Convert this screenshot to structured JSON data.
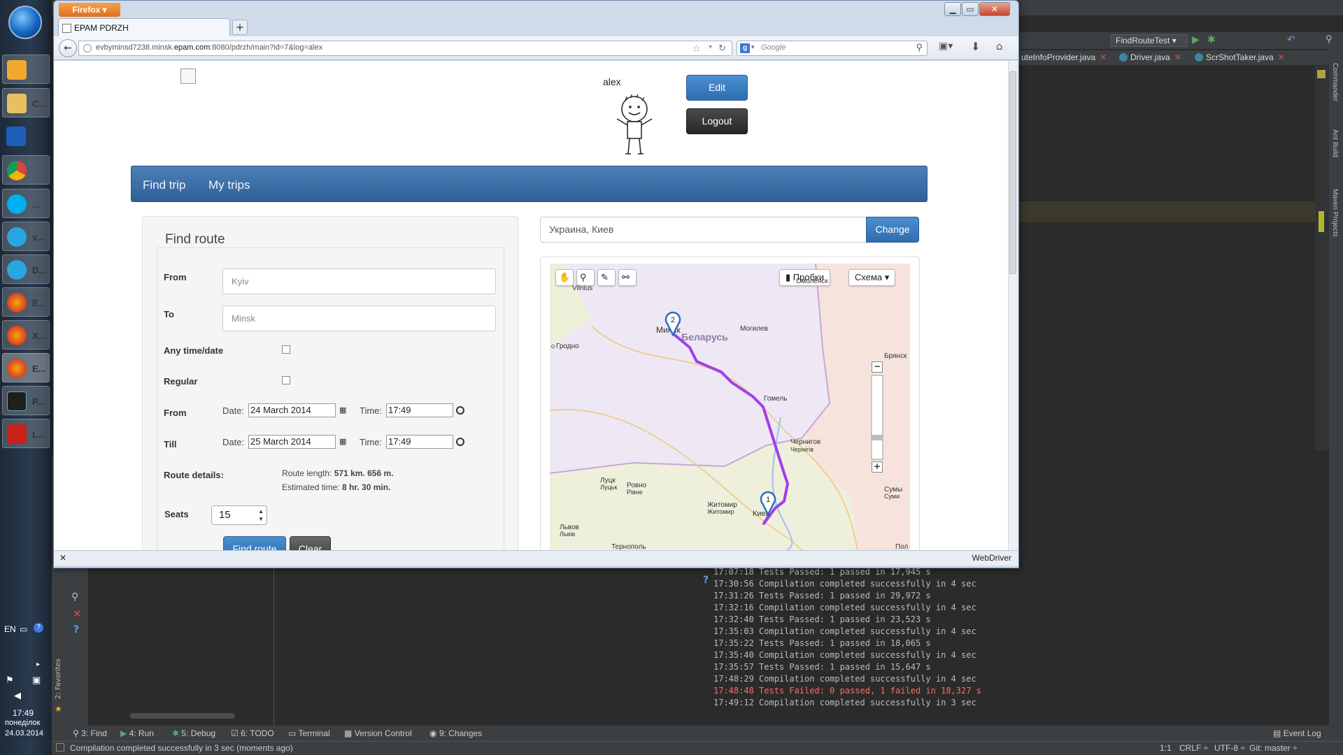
{
  "os": {
    "taskbar_items": [
      {
        "icon": "outlook-icon",
        "label": ""
      },
      {
        "icon": "folder-icon",
        "label": "C..."
      },
      {
        "icon": "video-editor-icon",
        "label": ""
      },
      {
        "icon": "chrome-icon",
        "label": ""
      },
      {
        "icon": "skype-icon",
        "label": "..."
      },
      {
        "icon": "chat-icon",
        "label": "v..."
      },
      {
        "icon": "chat-icon",
        "label": "D..."
      },
      {
        "icon": "firefox-icon",
        "label": "E..."
      },
      {
        "icon": "firefox-icon",
        "label": "X..."
      },
      {
        "icon": "firefox-icon",
        "label": "E..."
      },
      {
        "icon": "intellij-icon",
        "label": "P..."
      },
      {
        "icon": "pdf-icon",
        "label": "L..."
      }
    ],
    "language": "EN",
    "clock_time": "17:49",
    "clock_day": "понеділок",
    "clock_date": "24.03.2014"
  },
  "ide": {
    "run_config": "FindRouteTest",
    "editor_tabs": [
      {
        "label": "uteInfoProvider.java"
      },
      {
        "label": "Driver.java"
      },
      {
        "label": "ScrShotTaker.java"
      }
    ],
    "right_strips": [
      "Commander",
      "Ant Build",
      "Maven Projects"
    ],
    "favorites_label": "2: Favorites",
    "console_lines": [
      {
        "text": "17:07:18 Tests Passed: 1 passed in 17,945 s",
        "fail": false
      },
      {
        "text": "17:30:56 Compilation completed successfully in 4 sec",
        "fail": false
      },
      {
        "text": "17:31:26 Tests Passed: 1 passed in 29,972 s",
        "fail": false
      },
      {
        "text": "17:32:16 Compilation completed successfully in 4 sec",
        "fail": false
      },
      {
        "text": "17:32:40 Tests Passed: 1 passed in 23,523 s",
        "fail": false
      },
      {
        "text": "17:35:03 Compilation completed successfully in 4 sec",
        "fail": false
      },
      {
        "text": "17:35:22 Tests Passed: 1 passed in 18,065 s",
        "fail": false
      },
      {
        "text": "17:35:40 Compilation completed successfully in 4 sec",
        "fail": false
      },
      {
        "text": "17:35:57 Tests Passed: 1 passed in 15,647 s",
        "fail": false
      },
      {
        "text": "17:48:29 Compilation completed successfully in 4 sec",
        "fail": false
      },
      {
        "text": "17:48:48 Tests Failed: 0 passed, 1 failed in 18,327 s",
        "fail": true
      },
      {
        "text": "17:49:12 Compilation completed successfully in 3 sec",
        "fail": false
      }
    ],
    "bottom_tools": [
      "3: Find",
      "4: Run",
      "5: Debug",
      "6: TODO",
      "Terminal",
      "Version Control",
      "9: Changes"
    ],
    "event_log": "Event Log",
    "status_message": "Compilation completed successfully in 3 sec (moments ago)",
    "status_right": {
      "position": "1:1",
      "line_sep": "CRLF ÷",
      "encoding": "UTF-8 ÷",
      "vcs": "Git: master ÷"
    }
  },
  "browser": {
    "menu_label": "Firefox",
    "tab_title": "EPAM PDRZH",
    "url_prefix": "evbyminsd7238.minsk.",
    "url_domain": "epam.com",
    "url_suffix": ":8080/pdrzh/main?id=7&log=alex",
    "search_placeholder": "Google",
    "findbar_label": "WebDriver"
  },
  "page": {
    "username": "alex",
    "edit_label": "Edit",
    "logout_label": "Logout",
    "nav": [
      "Find trip",
      "My trips"
    ],
    "form_title": "Find route",
    "from_label": "From",
    "from_placeholder": "Kyiv",
    "to_label": "To",
    "to_placeholder": "Minsk",
    "any_time_label": "Any time/date",
    "regular_label": "Regular",
    "from_date_label": "From",
    "till_label": "Till",
    "date_label": "Date:",
    "time_label": "Time:",
    "from_date": "24 March 2014",
    "from_time": "17:49",
    "till_date": "25 March 2014",
    "till_time": "17:49",
    "route_details_label": "Route details:",
    "route_length_label": "Route length:",
    "route_length_value": "571 km. 656 m.",
    "estimated_time_label": "Estimated time:",
    "estimated_time_value": "8 hr. 30 min.",
    "seats_label": "Seats",
    "seats_value": "15",
    "find_route_label": "Find route",
    "clear_label": "Clear",
    "address_value": "Украина, Киев",
    "change_label": "Change",
    "map": {
      "traffic_label": "Пробки",
      "layer_label": "Схема",
      "country_label": "Беларусь",
      "route_color": "#a33ee8",
      "markers": [
        "1",
        "2"
      ],
      "cities": [
        {
          "name": "Vilnius"
        },
        {
          "name": "Смоленск"
        },
        {
          "name": "Минск"
        },
        {
          "name": "Могилев"
        },
        {
          "name": "Гродно"
        },
        {
          "name": "Брянск"
        },
        {
          "name": "Гомель"
        },
        {
          "name": "Чернигов"
        },
        {
          "name": "Чернігів"
        },
        {
          "name": "Луцк"
        },
        {
          "name": "Луцьк"
        },
        {
          "name": "Ровно"
        },
        {
          "name": "Рівне"
        },
        {
          "name": "Житомир"
        },
        {
          "name": "Житомир"
        },
        {
          "name": "Киев"
        },
        {
          "name": "Сумы"
        },
        {
          "name": "Суми"
        },
        {
          "name": "Львов"
        },
        {
          "name": "Львів"
        },
        {
          "name": "Тернополь"
        },
        {
          "name": "Пол"
        }
      ]
    }
  }
}
